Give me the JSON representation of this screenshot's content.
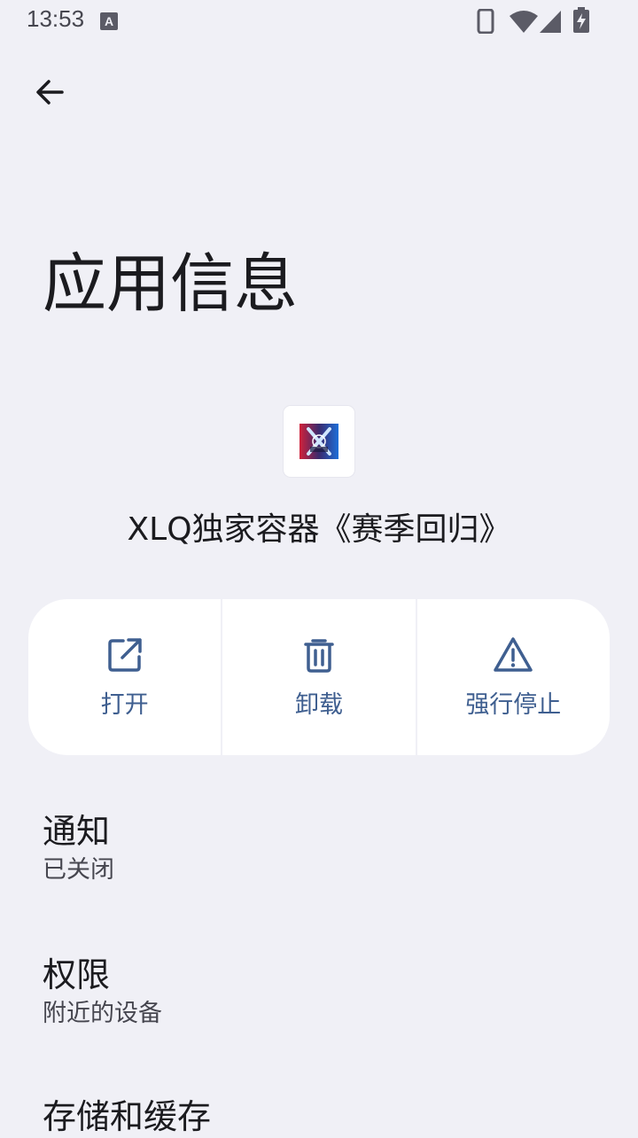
{
  "status_bar": {
    "time": "13:53",
    "icons": [
      "keyboard-a-icon",
      "phone-icon",
      "wifi-icon",
      "signal-icon",
      "battery-charging-icon"
    ]
  },
  "header": {
    "back_icon": "arrow-left-icon"
  },
  "page": {
    "title": "应用信息"
  },
  "app": {
    "icon": "app-logo-icon",
    "name": "XLQ独家容器《赛季回归》"
  },
  "actions": [
    {
      "label": "打开",
      "icon": "open-external-icon"
    },
    {
      "label": "卸载",
      "icon": "trash-icon"
    },
    {
      "label": "强行停止",
      "icon": "warning-triangle-icon"
    }
  ],
  "settings": [
    {
      "title": "通知",
      "subtitle": "已关闭"
    },
    {
      "title": "权限",
      "subtitle": "附近的设备"
    },
    {
      "title": "存储和缓存",
      "subtitle": ""
    }
  ],
  "colors": {
    "background": "#f0f0f6",
    "card": "#ffffff",
    "accent": "#3f5f90",
    "text_primary": "#1b1b1f",
    "text_secondary": "#46464f"
  }
}
